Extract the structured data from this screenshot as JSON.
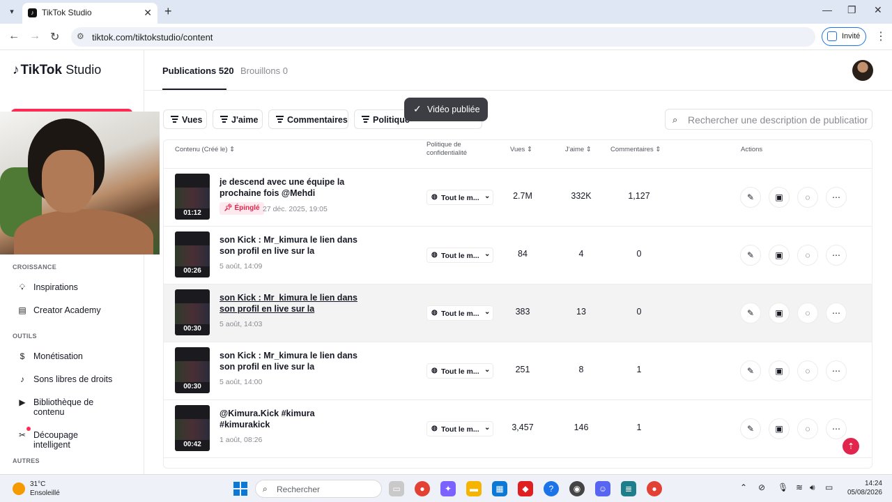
{
  "browser": {
    "tab_title": "TikTok Studio",
    "url": "tiktok.com/tiktokstudio/content",
    "guest_label": "Invité"
  },
  "app": {
    "logo_brand": "TikTok",
    "logo_product": "Studio"
  },
  "sidebar": {
    "sections": [
      {
        "label": "CROISSANCE",
        "items": [
          {
            "label": "Inspirations",
            "icon": "lightbulb-icon"
          },
          {
            "label": "Creator Academy",
            "icon": "book-icon"
          }
        ]
      },
      {
        "label": "OUTILS",
        "items": [
          {
            "label": "Monétisation",
            "icon": "dollar-icon"
          },
          {
            "label": "Sons libres de droits",
            "icon": "music-note-icon"
          },
          {
            "label": "Bibliothèque de contenu",
            "icon": "play-square-icon"
          },
          {
            "label": "Découpage intelligent",
            "icon": "smart-cut-icon"
          }
        ]
      },
      {
        "label": "AUTRES",
        "items": []
      }
    ]
  },
  "header": {
    "tab_publications": "Publications 520",
    "tab_drafts": "Brouillons 0"
  },
  "filters": [
    "Vues",
    "J'aime",
    "Commentaires",
    "Politique"
  ],
  "toast": {
    "text": "Vidéo publiée"
  },
  "search": {
    "placeholder": "Rechercher une description de publication"
  },
  "table": {
    "headers": {
      "content": "Contenu (Créé le)",
      "privacy": "Politique de confidentialité",
      "views": "Vues",
      "likes": "J'aime",
      "comments": "Commentaires",
      "actions": "Actions"
    },
    "rows": [
      {
        "duration": "01:12",
        "title": "je descend avec une équipe la prochaine fois @Mehdi",
        "pinned": "Épinglé",
        "date": "27 déc. 2025, 19:05",
        "privacy": "Tout le m...",
        "views": "2.7M",
        "likes": "332K",
        "comments": "1,127"
      },
      {
        "duration": "00:26",
        "title": "son Kick : Mr_kimura le lien dans son profil en live sur la plateform...",
        "pinned": "",
        "date": "5 août, 14:09",
        "privacy": "Tout le m...",
        "views": "84",
        "likes": "4",
        "comments": "0"
      },
      {
        "duration": "00:30",
        "title": "son Kick : Mr_kimura le lien dans son profil en live sur la plateform...",
        "pinned": "",
        "date": "5 août, 14:03",
        "privacy": "Tout le m...",
        "views": "383",
        "likes": "13",
        "comments": "0"
      },
      {
        "duration": "00:30",
        "title": "son Kick : Mr_kimura le lien dans son profil en live sur la plateform...",
        "pinned": "",
        "date": "5 août, 14:00",
        "privacy": "Tout le m...",
        "views": "251",
        "likes": "8",
        "comments": "1"
      },
      {
        "duration": "00:42",
        "title": "@Kimura.Kick #kimura #kimurakick",
        "pinned": "",
        "date": "1 août, 08:26",
        "privacy": "Tout le m...",
        "views": "3,457",
        "likes": "146",
        "comments": "1"
      }
    ]
  },
  "taskbar": {
    "temperature": "31°C",
    "weather": "Ensoleillé",
    "search_label": "Rechercher",
    "time": "14:24",
    "date": "05/08/2026"
  },
  "colors": {
    "accent": "#fe2c55",
    "pin_text": "#e0264d",
    "toast_bg": "#3d3e43"
  }
}
